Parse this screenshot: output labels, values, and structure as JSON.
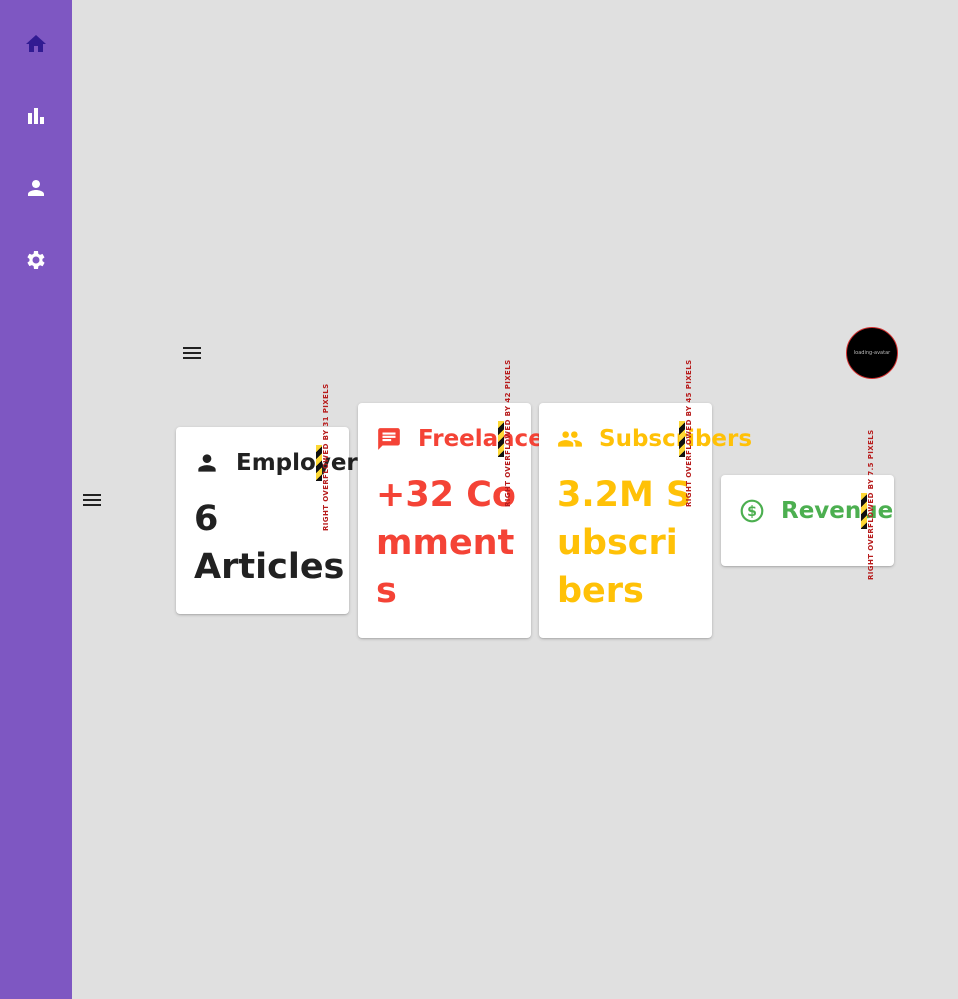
{
  "nav_rail": {
    "items": [
      {
        "icon": "home-icon",
        "color": "#311b92"
      },
      {
        "icon": "bar-chart-icon",
        "color": "#ffffff"
      },
      {
        "icon": "person-icon",
        "color": "#ffffff"
      },
      {
        "icon": "settings-icon",
        "color": "#ffffff"
      }
    ],
    "background": "#7e57c2"
  },
  "avatar": {
    "label": "loading-avatar"
  },
  "cards": [
    {
      "icon": "person-icon",
      "title": "Employers",
      "value": "6 Articles",
      "color": "#212121",
      "overflow_text": "RIGHT OVERFLOWED BY 31 PIXELS"
    },
    {
      "icon": "comment-icon",
      "title": "Freelancers",
      "value": "+32 Comments",
      "color": "#f44336",
      "overflow_text": "RIGHT OVERFLOWED BY 42 PIXELS"
    },
    {
      "icon": "people-icon",
      "title": "Subscribers",
      "value": "3.2M Subscribers",
      "color": "#ffc107",
      "overflow_text": "RIGHT OVERFLOWED BY 45 PIXELS"
    },
    {
      "icon": "dollar-icon",
      "title": "Revenue",
      "value": "",
      "color": "#4caf50",
      "overflow_text": "RIGHT OVERFLOWED BY 7.5 PIXELS"
    }
  ]
}
